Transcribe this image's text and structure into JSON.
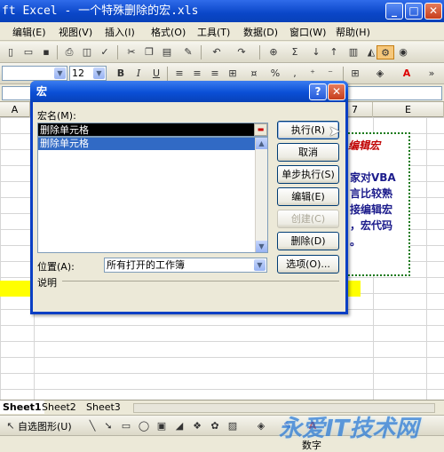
{
  "window": {
    "title": "ft Excel - 一个特殊删除的宏.xls",
    "min": "_",
    "max": "□",
    "close": "✕"
  },
  "menu": [
    "编辑(E)",
    "视图(V)",
    "插入(I)",
    "格式(O)",
    "工具(T)",
    "数据(D)",
    "窗口(W)",
    "帮助(H)"
  ],
  "toolbar2": {
    "font_size": "12",
    "bold": "B",
    "italic": "I",
    "underline": "U",
    "percent": "%"
  },
  "columns": {
    "A": "A",
    "seven": "7",
    "E": "E"
  },
  "textbox": {
    "line1": "编辑宏",
    "line2": "家对VBA",
    "line3": "言比较熟",
    "line4": "接编辑宏",
    "line5": "，宏代码",
    "line6": "。"
  },
  "dialog": {
    "title": "宏",
    "help": "?",
    "close": "✕",
    "macro_name_label": "宏名(M):",
    "macro_name_value": "删除单元格",
    "list_items": [
      "删除单元格"
    ],
    "location_label": "位置(A):",
    "location_value": "所有打开的工作簿",
    "description_label": "说明",
    "buttons": {
      "run": "执行(R)",
      "cancel": "取消",
      "step": "单步执行(S)",
      "edit": "编辑(E)",
      "create": "创建(C)",
      "delete": "删除(D)",
      "options": "选项(O)..."
    }
  },
  "sheets": [
    "Sheet1",
    "Sheet2",
    "Sheet3"
  ],
  "drawbar": {
    "autoshapes": "自选图形(U)"
  },
  "status": {
    "mode": "数字"
  },
  "watermark": "永爱IT技术网"
}
